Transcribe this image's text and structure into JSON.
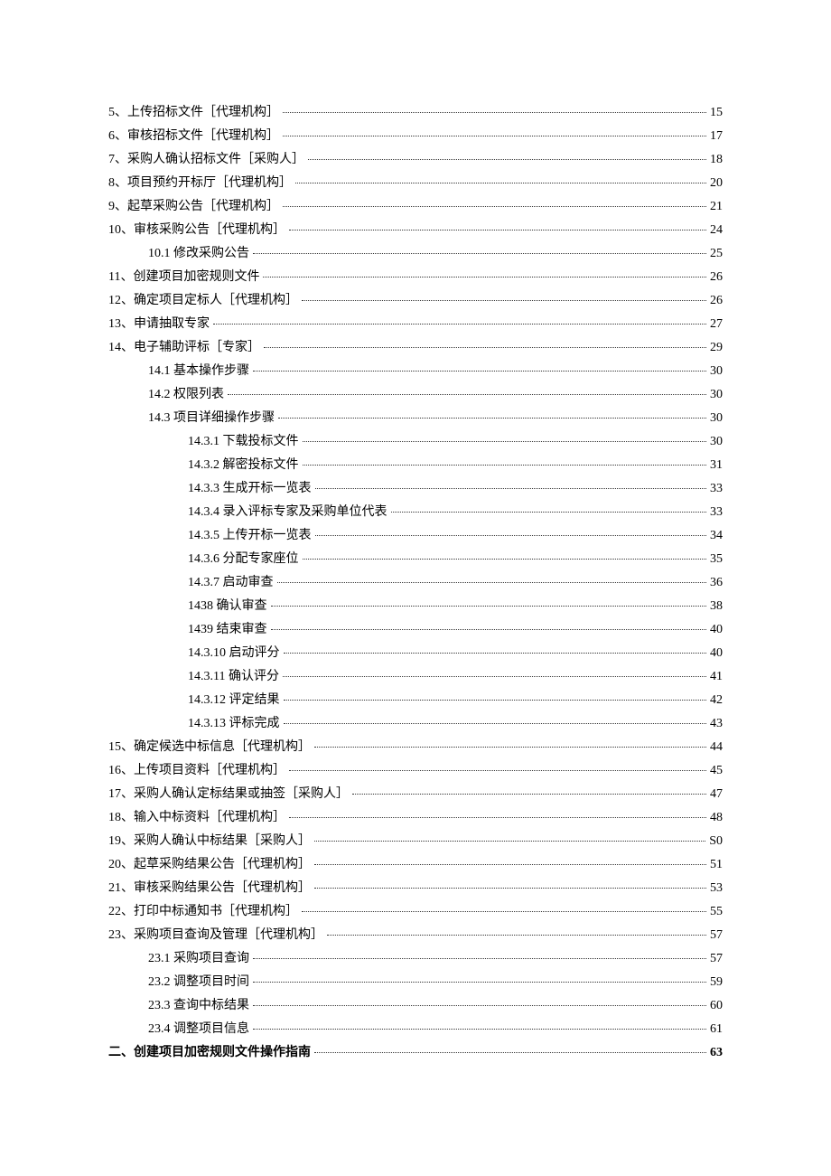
{
  "toc": [
    {
      "level": 1,
      "label": "5、上传招标文件［代理机构］",
      "page": "15"
    },
    {
      "level": 1,
      "label": "6、审核招标文件［代理机构］",
      "page": "17"
    },
    {
      "level": 1,
      "label": "7、采购人确认招标文件［采购人］",
      "page": "18"
    },
    {
      "level": 1,
      "label": "8、项目预约开标厅［代理机构］",
      "page": "20"
    },
    {
      "level": 1,
      "label": "9、起草采购公告［代理机构］",
      "page": "21"
    },
    {
      "level": 1,
      "label": "10、审核采购公告［代理机构］",
      "page": "24"
    },
    {
      "level": 2,
      "label": "10.1 修改采购公告",
      "page": "25"
    },
    {
      "level": 1,
      "label": "11、创建项目加密规则文件",
      "page": "26"
    },
    {
      "level": 1,
      "label": "12、确定项目定标人［代理机构］",
      "page": "26"
    },
    {
      "level": 1,
      "label": "13、申请抽取专家",
      "page": "27"
    },
    {
      "level": 1,
      "label": "14、电子辅助评标［专家］",
      "page": "29"
    },
    {
      "level": 2,
      "label": "14.1  基本操作步骤",
      "page": "30"
    },
    {
      "level": 2,
      "label": "14.2  权限列表",
      "page": "30"
    },
    {
      "level": 2,
      "label": "14.3 项目详细操作步骤",
      "page": "30"
    },
    {
      "level": 3,
      "label": "14.3.1 下载投标文件",
      "page": "30"
    },
    {
      "level": 3,
      "label": "14.3.2 解密投标文件",
      "page": "31"
    },
    {
      "level": 3,
      "label": "14.3.3 生成开标一览表",
      "page": "33"
    },
    {
      "level": 3,
      "label": "14.3.4 录入评标专家及采购单位代表",
      "page": "33"
    },
    {
      "level": 3,
      "label": "14.3.5 上传开标一览表",
      "page": "34"
    },
    {
      "level": 3,
      "label": "14.3.6 分配专家座位",
      "page": "35"
    },
    {
      "level": 3,
      "label": "14.3.7 启动审查",
      "page": "36"
    },
    {
      "level": 3,
      "label": "1438 确认审查",
      "page": "38"
    },
    {
      "level": 3,
      "label": "1439 结束审查",
      "page": "40"
    },
    {
      "level": 3,
      "label": "14.3.10 启动评分",
      "page": "40"
    },
    {
      "level": 3,
      "label": "14.3.11 确认评分",
      "page": "41"
    },
    {
      "level": 3,
      "label": "14.3.12 评定结果",
      "page": "42"
    },
    {
      "level": 3,
      "label": "14.3.13 评标完成",
      "page": "43"
    },
    {
      "level": 1,
      "label": "15、确定候选中标信息［代理机构］",
      "page": "44"
    },
    {
      "level": 1,
      "label": "16、上传项目资料［代理机构］",
      "page": "45"
    },
    {
      "level": 1,
      "label": "17、采购人确认定标结果或抽签［采购人］",
      "page": "47"
    },
    {
      "level": 1,
      "label": "18、输入中标资料［代理机构］",
      "page": "48"
    },
    {
      "level": 1,
      "label": "19、采购人确认中标结果［采购人］",
      "page": "S0"
    },
    {
      "level": 1,
      "label": "20、起草采购结果公告［代理机构］",
      "page": "51"
    },
    {
      "level": 1,
      "label": "21、审核采购结果公告［代理机构］",
      "page": "53"
    },
    {
      "level": 1,
      "label": "22、打印中标通知书［代理机构］",
      "page": "55"
    },
    {
      "level": 1,
      "label": "23、采购项目查询及管理［代理机构］",
      "page": "57"
    },
    {
      "level": 2,
      "label": "23.1  采购项目查询",
      "page": "57"
    },
    {
      "level": 2,
      "label": "23.2  调整项目时间",
      "page": "59"
    },
    {
      "level": 2,
      "label": "23.3  查询中标结果",
      "page": "60"
    },
    {
      "level": 2,
      "label": "23.4 调整项目信息",
      "page": "61"
    },
    {
      "level": 0,
      "label": "二、创建项目加密规则文件操作指南",
      "page": "63"
    }
  ]
}
